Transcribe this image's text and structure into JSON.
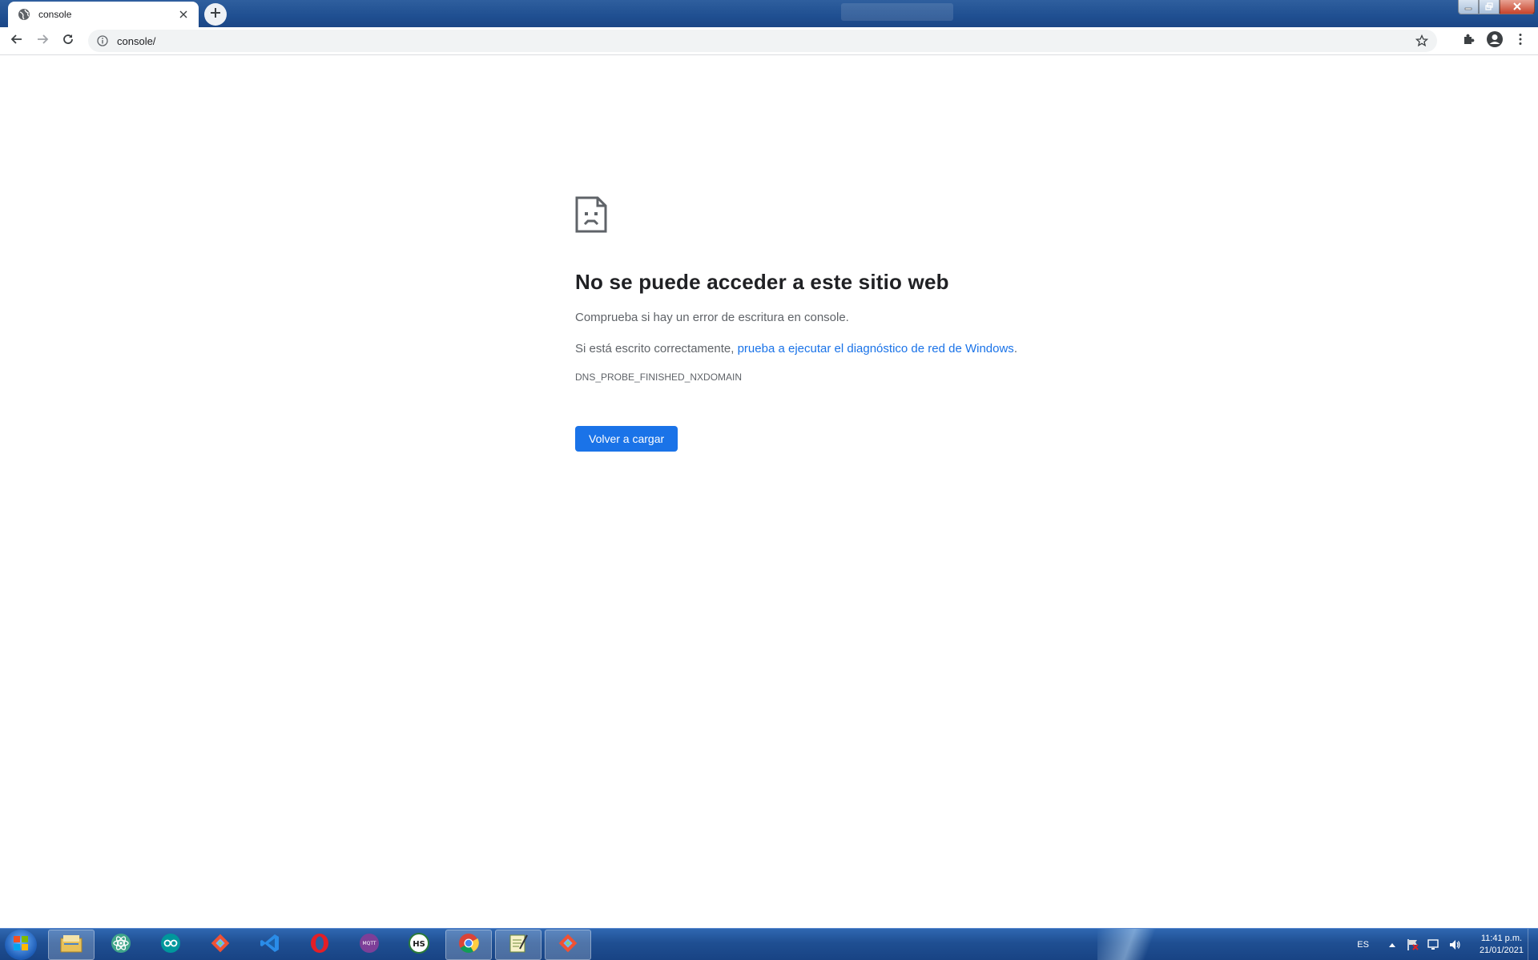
{
  "browser": {
    "tab": {
      "title": "console",
      "favicon": "globe-icon"
    },
    "new_tab_icon": "plus-icon",
    "address": {
      "url": "console/"
    },
    "icons": [
      "back-arrow-icon",
      "forward-arrow-icon",
      "reload-icon",
      "info-icon",
      "star-icon",
      "extensions-puzzle-icon",
      "profile-avatar-icon",
      "menu-dots-icon"
    ]
  },
  "error": {
    "title": "No se puede acceder a este sitio web",
    "line1": "Comprueba si hay un error de escritura en console.",
    "line2_prefix": "Si está escrito correctamente, ",
    "line2_link": "prueba a ejecutar el diagnóstico de red de Windows",
    "line2_suffix": ".",
    "code": "DNS_PROBE_FINISHED_NXDOMAIN",
    "button": "Volver a cargar"
  },
  "taskbar": {
    "apps": [
      {
        "icon": "file-explorer-icon",
        "active": false
      },
      {
        "icon": "atom-icon",
        "active": false
      },
      {
        "icon": "arduino-icon",
        "active": false
      },
      {
        "icon": "git-icon",
        "active": false
      },
      {
        "icon": "vscode-icon",
        "active": false
      },
      {
        "icon": "opera-icon",
        "active": false
      },
      {
        "icon": "mqtt-icon",
        "active": false,
        "label": "MQTT"
      },
      {
        "icon": "hs-icon",
        "active": false,
        "label": "HS"
      },
      {
        "icon": "chrome-icon",
        "active": true
      },
      {
        "icon": "notepad-icon",
        "active": true
      },
      {
        "icon": "git-gui-icon",
        "active": true
      }
    ],
    "tray": {
      "language": "ES",
      "time": "11:41 p.m.",
      "date": "21/01/2021"
    }
  },
  "colors": {
    "link": "#1a73e8",
    "button": "#1a73e8",
    "text": "#202124",
    "secondary": "#5f6368"
  }
}
